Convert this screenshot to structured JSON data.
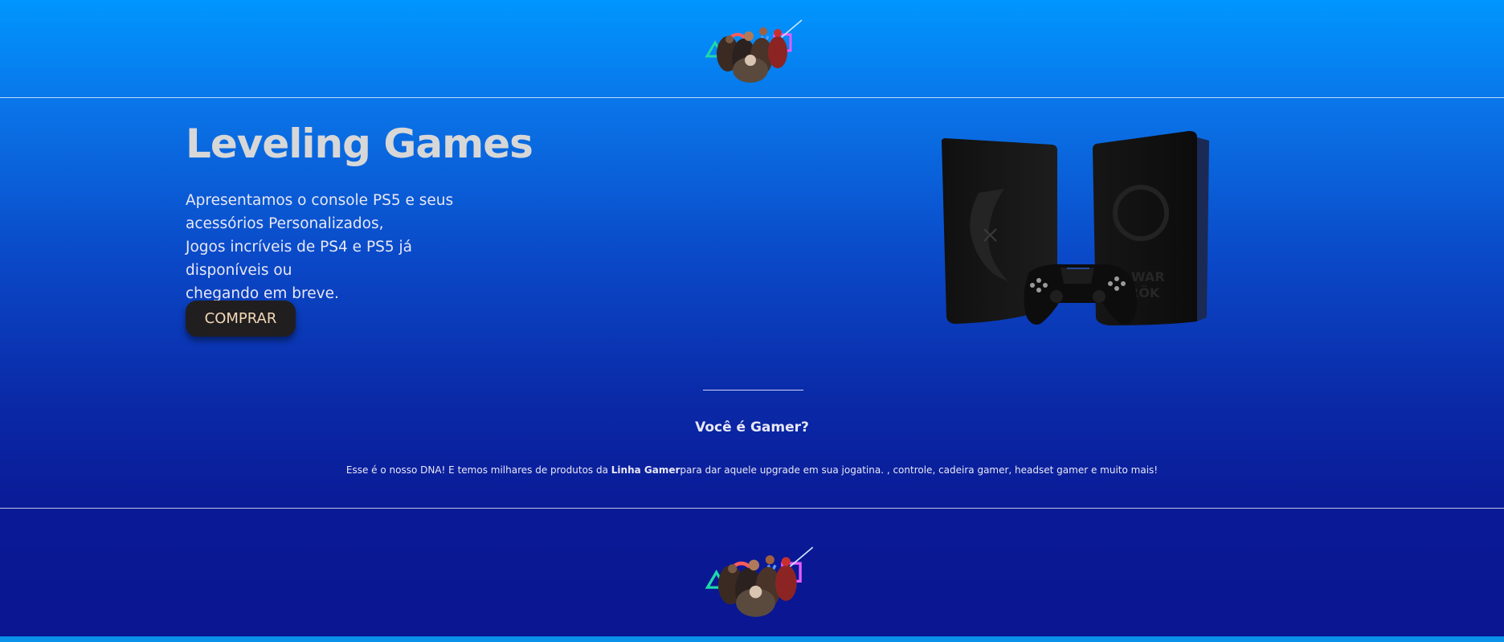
{
  "brand": {
    "logo_alt": "Leveling Games logo",
    "logo_icon": "playstation-heroes-logo"
  },
  "hero": {
    "title": "Leveling Games",
    "paragraph_lines": [
      "Apresentamos o console PS5 e seus",
      "acessórios Personalizados,",
      "Jogos incríveis de PS4 e PS5 já disponíveis ou",
      "chegando em breve."
    ],
    "buy_label": "COMPRAR",
    "image_alt": "PS5 God of War Ragnarök edition consoles and DualSense controller",
    "console_text": "WAR",
    "console_text2": "RÖK"
  },
  "section": {
    "title": "Você é Gamer?",
    "text_before": "Esse é o nosso DNA! E temos milhares de produtos da ",
    "text_bold": "Linha Gamer",
    "text_after": "para dar aquele upgrade em sua jogatina. , controle, cadeira gamer, headset gamer e muito mais!"
  },
  "colors": {
    "background_top": "#0096ff",
    "background_bottom": "#0a1591",
    "button_bg": "#211e1f",
    "button_text": "#f2d9b8",
    "title_color": "#d7d7d7"
  }
}
